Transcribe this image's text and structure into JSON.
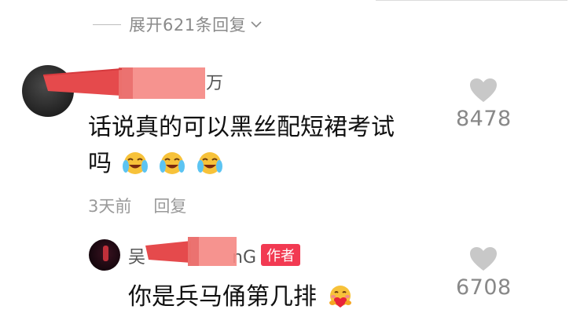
{
  "thread": {
    "expand_label": "展开621条回复",
    "icons": {
      "expand": "chevron-down-icon",
      "like": "heart-icon"
    }
  },
  "comments": [
    {
      "username_visible": "万",
      "text_line1": "话说真的可以黑丝配短裙考试",
      "text_line2": "吗",
      "emojis": [
        "laugh-cry-emoji",
        "laugh-cry-emoji",
        "laugh-cry-emoji"
      ],
      "time": "3天前",
      "reply_label": "回复",
      "likes": "8478"
    },
    {
      "username_visible_start": "吴",
      "username_visible_end": "nG",
      "badge": "作者",
      "text": "你是兵马俑第几排",
      "emoji": "heart-hug-emoji",
      "likes": "6708"
    }
  ],
  "colors": {
    "badge": "#f23a52",
    "redaction": "#f47d7e",
    "muted_text": "#8a8a8a"
  }
}
